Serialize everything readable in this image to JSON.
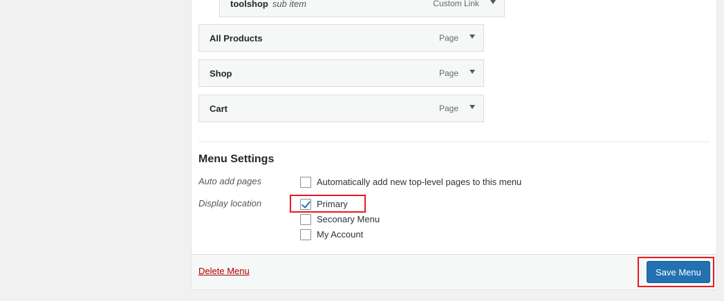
{
  "menu_structure": {
    "items": [
      {
        "title": "toolshop",
        "sub_label": "sub item",
        "type": "Custom Link"
      },
      {
        "title": "All Products",
        "type": "Page"
      },
      {
        "title": "Shop",
        "type": "Page"
      },
      {
        "title": "Cart",
        "type": "Page"
      }
    ]
  },
  "menu_settings": {
    "heading": "Menu Settings",
    "auto_add": {
      "label": "Auto add pages",
      "option": "Automatically add new top-level pages to this menu",
      "checked": false
    },
    "display_location": {
      "label": "Display location",
      "options": [
        {
          "label": "Primary",
          "checked": true
        },
        {
          "label": "Seconary Menu",
          "checked": false
        },
        {
          "label": "My Account",
          "checked": false
        }
      ]
    }
  },
  "footer": {
    "delete_label": "Delete Menu",
    "save_label": "Save Menu"
  },
  "colors": {
    "accent": "#2271b1",
    "highlight": "#e8191f",
    "delete": "#aa0000"
  }
}
